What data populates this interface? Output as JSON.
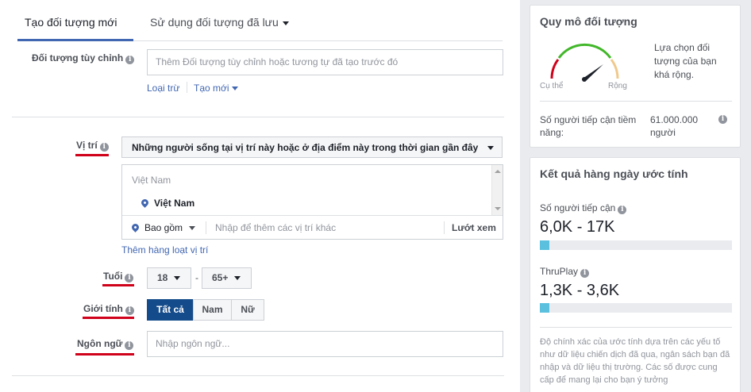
{
  "tabs": {
    "new_audience": "Tạo đối tượng mới",
    "saved_audience": "Sử dụng đối tượng đã lưu"
  },
  "custom_audience": {
    "label": "Đối tượng tùy chỉnh",
    "placeholder": "Thêm Đối tượng tùy chỉnh hoặc tương tự đã tạo trước đó",
    "exclude": "Loại trừ",
    "create_new": "Tạo mới"
  },
  "location": {
    "label": "Vị trí",
    "dropdown": "Những người sống tại vị trí này hoặc ở địa điểm này trong thời gian gần đây",
    "country_header": "Việt Nam",
    "selected": "Việt Nam",
    "include": "Bao gồm",
    "add_placeholder": "Nhập để thêm các vị trí khác",
    "browse": "Lướt xem",
    "bulk_add": "Thêm hàng loạt vị trí"
  },
  "age": {
    "label": "Tuổi",
    "min": "18",
    "max": "65+",
    "dash": "-"
  },
  "gender": {
    "label": "Giới tính",
    "all": "Tất cả",
    "male": "Nam",
    "female": "Nữ"
  },
  "language": {
    "label": "Ngôn ngữ",
    "placeholder": "Nhập ngôn ngữ..."
  },
  "audience_size": {
    "title": "Quy mô đối tượng",
    "specific": "Cụ thể",
    "broad": "Rộng",
    "description": "Lựa chọn đối tượng của bạn khá rộng.",
    "reach_label": "Số người tiếp cận tiềm năng:",
    "reach_value": "61.000.000 người"
  },
  "daily_results": {
    "title": "Kết quả hàng ngày ước tính",
    "reach_label": "Số người tiếp cận",
    "reach_value": "6,0K - 17K",
    "reach_fill": 0.05,
    "thruplay_label": "ThruPlay",
    "thruplay_value": "1,3K - 3,6K",
    "thruplay_fill": 0.05,
    "disclaimer": "Độ chính xác của ước tính dựa trên các yếu tố như dữ liệu chiến dịch đã qua, ngân sách bạn đã nhập và dữ liệu thị trường. Các số được cung cấp để mang lại cho bạn ý tưởng"
  },
  "colors": {
    "accent": "#4267b2",
    "primary_button": "#144b8a",
    "underline": "#d0021b",
    "bar_fill": "#5bc0de",
    "gauge_green": "#42b72a",
    "gauge_red": "#d0021b",
    "gauge_tan": "#f0c98b"
  },
  "icons": {
    "info": "info-icon",
    "location": "map-pin-icon",
    "dropdown": "caret-down-icon",
    "gauge": "gauge-icon"
  }
}
